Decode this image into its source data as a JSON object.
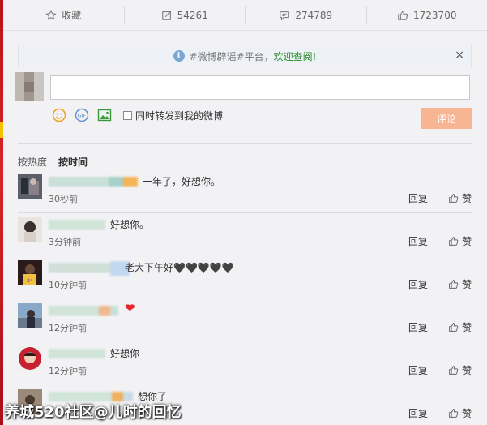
{
  "action_bar": {
    "favorite_label": "收藏",
    "repost_count": "54261",
    "comment_count": "274789",
    "like_count": "1723700"
  },
  "notice": {
    "text": "#微博辟谣#平台，",
    "link": "欢迎查阅!",
    "close": "×"
  },
  "composer": {
    "input_value": "",
    "repost_checkbox_label": "同时转发到我的微博",
    "submit_label": "评论"
  },
  "sort": {
    "by_heat": "按热度",
    "by_time": "按时间"
  },
  "comments": [
    {
      "text": "一年了，好想你。",
      "time": "30秒前",
      "reply": "回复",
      "like": "赞"
    },
    {
      "text": "好想你。",
      "time": "3分钟前",
      "reply": "回复",
      "like": "赞"
    },
    {
      "text": "老大下午好🖤🖤🖤🖤🖤",
      "time": "10分钟前",
      "reply": "回复",
      "like": "赞"
    },
    {
      "text": "❤",
      "time": "12分钟前",
      "reply": "回复",
      "like": "赞"
    },
    {
      "text": "好想你",
      "time": "12分钟前",
      "reply": "回复",
      "like": "赞"
    },
    {
      "text": "想你了",
      "time": "",
      "reply": "回复",
      "like": "赞"
    }
  ],
  "watermark": "养城520社区@儿时的回忆",
  "colors": {
    "accent_red": "#d8242a",
    "submit_bg": "#f7b593",
    "link_green": "#2a8a2a",
    "heart_red": "#e8262a"
  },
  "icons": [
    "star-icon",
    "repost-icon",
    "comment-icon",
    "thumbs-up-icon",
    "info-icon",
    "close-icon",
    "emoji-icon",
    "gif-icon",
    "image-icon"
  ]
}
